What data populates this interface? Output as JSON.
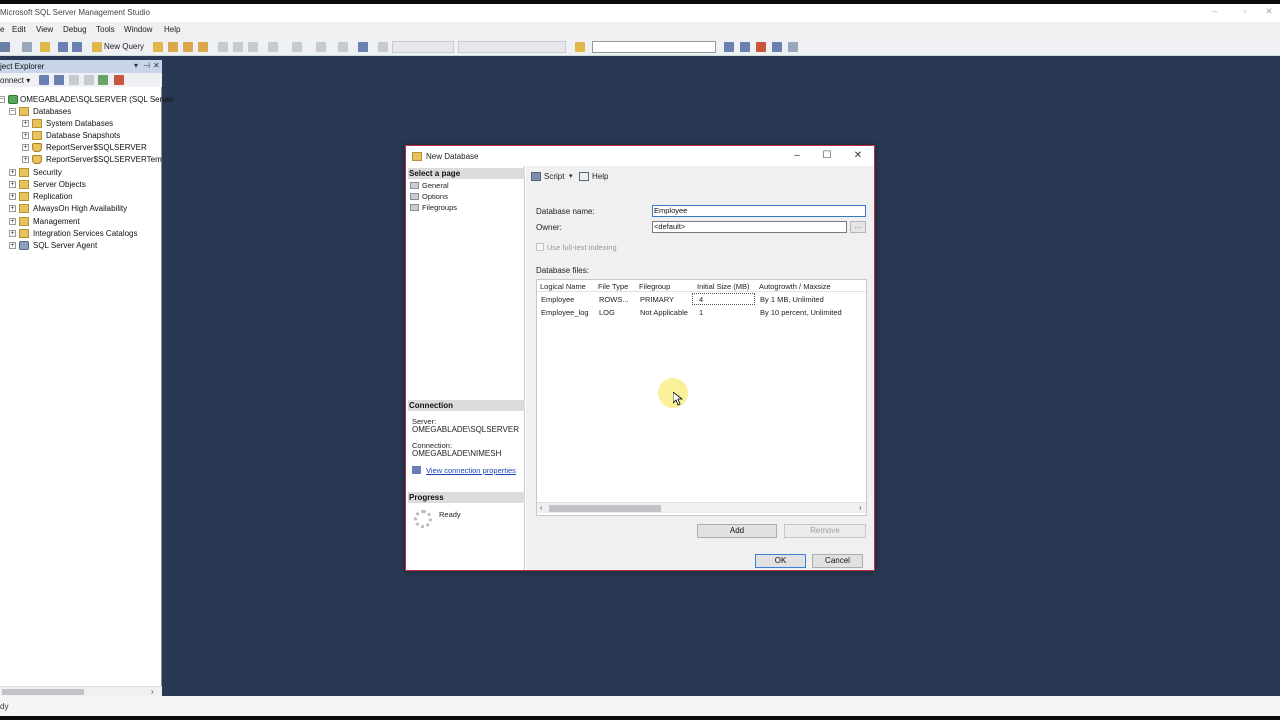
{
  "app": {
    "title": "Microsoft SQL Server Management Studio",
    "menu": [
      "Edit",
      "View",
      "Debug",
      "Tools",
      "Window",
      "Help"
    ],
    "new_query": "New Query",
    "status": "dy"
  },
  "object_explorer": {
    "title": "ject Explorer",
    "connect": "onnect ▾",
    "nodes": [
      {
        "label": "OMEGABLADE\\SQLSERVER (SQL Server",
        "exp": "−",
        "icon": "server-icon"
      },
      {
        "label": "Databases",
        "exp": "−",
        "icon": "folder-icon"
      },
      {
        "label": "System Databases",
        "exp": "+",
        "icon": "folder-icon"
      },
      {
        "label": "Database Snapshots",
        "exp": "+",
        "icon": "folder-icon"
      },
      {
        "label": "ReportServer$SQLSERVER",
        "exp": "+",
        "icon": "database-icon"
      },
      {
        "label": "ReportServer$SQLSERVERTempD",
        "exp": "+",
        "icon": "database-icon"
      },
      {
        "label": "Security",
        "exp": "+",
        "icon": "folder-icon"
      },
      {
        "label": "Server Objects",
        "exp": "+",
        "icon": "folder-icon"
      },
      {
        "label": "Replication",
        "exp": "+",
        "icon": "folder-icon"
      },
      {
        "label": "AlwaysOn High Availability",
        "exp": "+",
        "icon": "folder-icon"
      },
      {
        "label": "Management",
        "exp": "+",
        "icon": "folder-icon"
      },
      {
        "label": "Integration Services Catalogs",
        "exp": "+",
        "icon": "folder-icon"
      },
      {
        "label": "SQL Server Agent",
        "exp": "+",
        "icon": "agent-icon"
      }
    ]
  },
  "dialog": {
    "title": "New Database",
    "select_page": "Select a page",
    "pages": [
      "General",
      "Options",
      "Filegroups"
    ],
    "toolbar": {
      "script": "Script",
      "help": "Help"
    },
    "connection": {
      "heading": "Connection",
      "server_label": "Server:",
      "server": "OMEGABLADE\\SQLSERVER",
      "connection_label": "Connection:",
      "connection": "OMEGABLADE\\NIMESH",
      "link": "View connection properties"
    },
    "progress": {
      "heading": "Progress",
      "status": "Ready"
    },
    "db_name_label": "Database name:",
    "db_name_value": "Employee",
    "owner_label": "Owner:",
    "owner_value": "<default>",
    "owner_browse": "...",
    "fulltext_label": "Use full-text indexing",
    "files_label": "Database files:",
    "columns": [
      "Logical Name",
      "File Type",
      "Filegroup",
      "Initial Size (MB)",
      "Autogrowth / Maxsize"
    ],
    "rows": [
      [
        "Employee",
        "ROWS...",
        "PRIMARY",
        "4",
        "By 1 MB, Unlimited"
      ],
      [
        "Employee_log",
        "LOG",
        "Not Applicable",
        "1",
        "By 10 percent, Unlimited"
      ]
    ],
    "add": "Add",
    "remove": "Remove",
    "ok": "OK",
    "cancel": "Cancel"
  },
  "colors": {
    "workspace": "#293955",
    "dialog_border": "#c02f3f",
    "link": "#1c46b8"
  }
}
